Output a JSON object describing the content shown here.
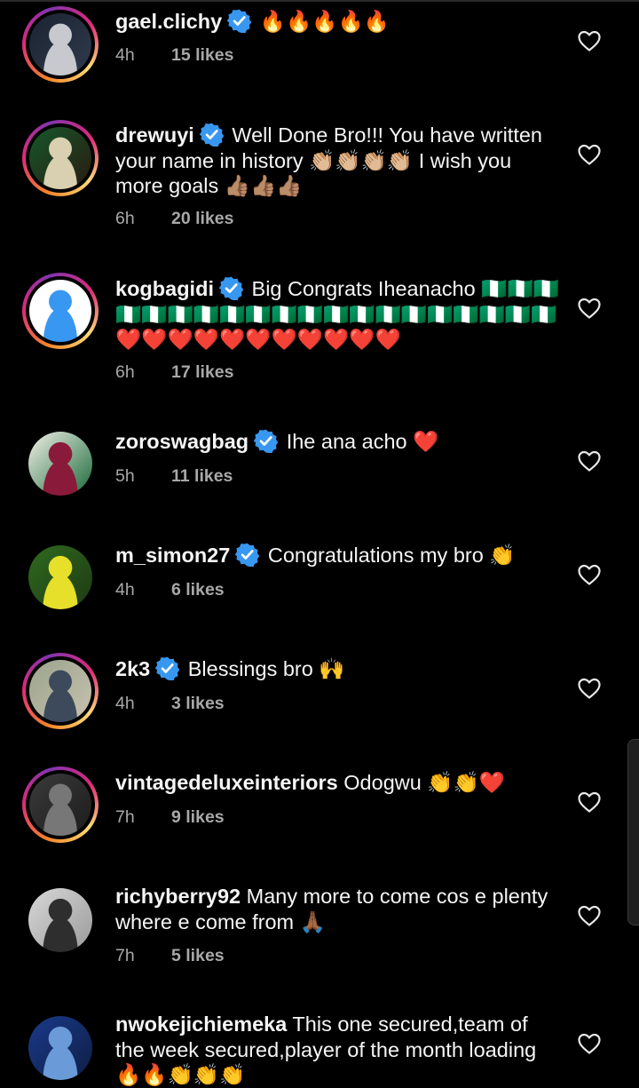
{
  "comments": [
    {
      "username": "gael.clichy",
      "verified": true,
      "text": " 🔥🔥🔥🔥🔥",
      "time": "4h",
      "likes": "15 likes",
      "avatar_style": "ring",
      "avatar_colors": [
        "#1b2330",
        "#c7c9cf",
        "#2e3a4d"
      ]
    },
    {
      "username": "drewuyi",
      "verified": true,
      "text": " Well Done Bro!!! You have written your name in history 👏🏼👏🏼👏🏼👏🏼 I wish you more goals 👍🏽👍🏽👍🏽",
      "time": "6h",
      "likes": "20 likes",
      "avatar_style": "ring",
      "avatar_colors": [
        "#16572a",
        "#d8d0b0",
        "#2a1a12"
      ]
    },
    {
      "username": "kogbagidi",
      "verified": true,
      "text": " Big Congrats Iheanacho 🇳🇬🇳🇬🇳🇬🇳🇬🇳🇬🇳🇬🇳🇬🇳🇬🇳🇬🇳🇬🇳🇬🇳🇬🇳🇬🇳🇬🇳🇬🇳🇬🇳🇬🇳🇬🇳🇬🇳🇬❤️❤️❤️❤️❤️❤️❤️❤️❤️❤️❤️",
      "time": "6h",
      "likes": "17 likes",
      "avatar_style": "ring",
      "avatar_colors": [
        "#ffffff",
        "#3897f0",
        "#ffffff"
      ]
    },
    {
      "username": "zoroswagbag",
      "verified": true,
      "text": " Ihe ana acho ❤️",
      "time": "5h",
      "likes": "11 likes",
      "avatar_style": "plain",
      "avatar_colors": [
        "#f2f0e8",
        "#8a1a3a",
        "#1a6a3a"
      ]
    },
    {
      "username": "m_simon27",
      "verified": true,
      "text": " Congratulations my bro 👏",
      "time": "4h",
      "likes": "6 likes",
      "avatar_style": "plain",
      "avatar_colors": [
        "#2f6a1e",
        "#e6e02a",
        "#1e3a14"
      ]
    },
    {
      "username": "2k3",
      "verified": true,
      "text": " Blessings bro 🙌",
      "time": "4h",
      "likes": "3 likes",
      "avatar_style": "ring",
      "avatar_colors": [
        "#9aa38c",
        "#3d4a5c",
        "#c9c2b0"
      ]
    },
    {
      "username": "vintagedeluxeinteriors",
      "verified": false,
      "text": " Odogwu 👏👏❤️",
      "time": "7h",
      "likes": "9 likes",
      "avatar_style": "ring",
      "avatar_colors": [
        "#3a3a3a",
        "#777777",
        "#1c1c1c"
      ]
    },
    {
      "username": "richyberry92",
      "verified": false,
      "text": " Many more to come cos e plenty where e come from 🙏🏾",
      "time": "7h",
      "likes": "5 likes",
      "avatar_style": "plain",
      "avatar_colors": [
        "#d8d8d8",
        "#2e2e2e",
        "#9a9a9a"
      ]
    },
    {
      "username": "nwokejichiemeka",
      "verified": false,
      "text": " This one secured,team of the week secured,player of the month loading 🔥🔥👏👏👏",
      "time": "",
      "likes": "",
      "avatar_style": "plain",
      "avatar_colors": [
        "#1a3a8a",
        "#6a9ad8",
        "#0e1e44"
      ]
    }
  ],
  "colors": {
    "verified_blue": "#3897f0",
    "meta_gray": "#a8a8a8",
    "background": "#000000"
  }
}
